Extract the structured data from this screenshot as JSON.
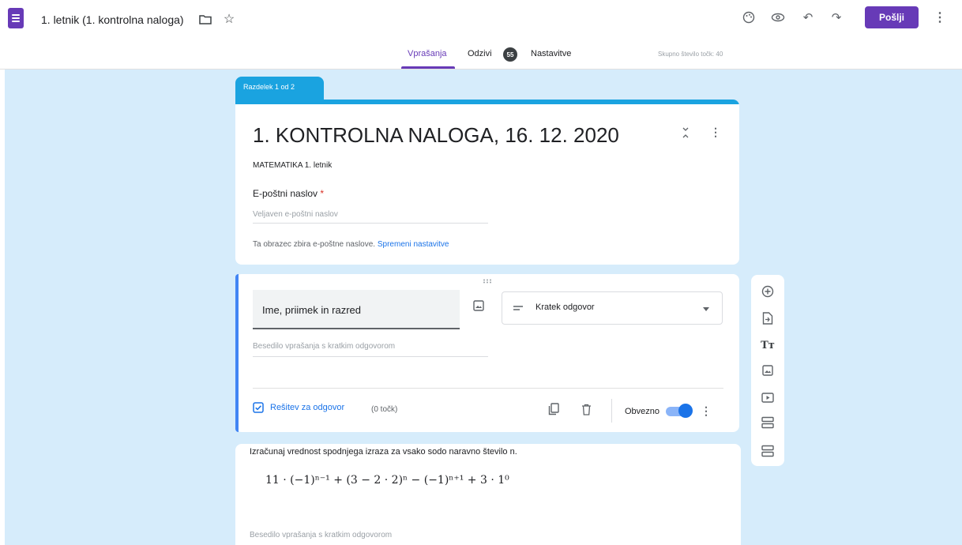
{
  "header": {
    "doc_title": "1. letnik (1. kontrolna naloga)",
    "send_label": "Pošlji"
  },
  "tabs": {
    "questions": "Vprašanja",
    "responses": "Odzivi",
    "responses_count": "55",
    "settings": "Nastavitve",
    "total_points": "Skupno število točk: 40"
  },
  "section": {
    "label": "Razdelek 1 od 2"
  },
  "form": {
    "title": "1. KONTROLNA NALOGA, 16. 12. 2020",
    "description": "MATEMATIKA 1. letnik",
    "email_label": "E-poštni naslov",
    "email_required_mark": "*",
    "email_placeholder": "Veljaven e-poštni naslov",
    "collect_note": "Ta obrazec zbira e-poštne naslove.",
    "collect_link": "Spremeni nastavitve"
  },
  "question1": {
    "title": "Ime, priimek in razred",
    "type": "Kratek odgovor",
    "answer_placeholder": "Besedilo vprašanja s kratkim odgovorom",
    "answer_key": "Rešitev za odgovor",
    "points": "(0 točk)",
    "required_label": "Obvezno",
    "required": true
  },
  "question2": {
    "text": "Izračunaj vrednost spodnjega izraza za vsako sodo naravno število n.",
    "formula": "11 · (−1)ⁿ⁻¹ + (3 − 2 · 2)ⁿ − (−1)ⁿ⁺¹ + 3 · 1⁰",
    "answer_placeholder": "Besedilo vprašanja s kratkim odgovorom"
  },
  "colors": {
    "accent": "#673ab7",
    "section": "#1aa3e0",
    "canvas": "#d6ecfb",
    "link": "#1a73e8"
  }
}
